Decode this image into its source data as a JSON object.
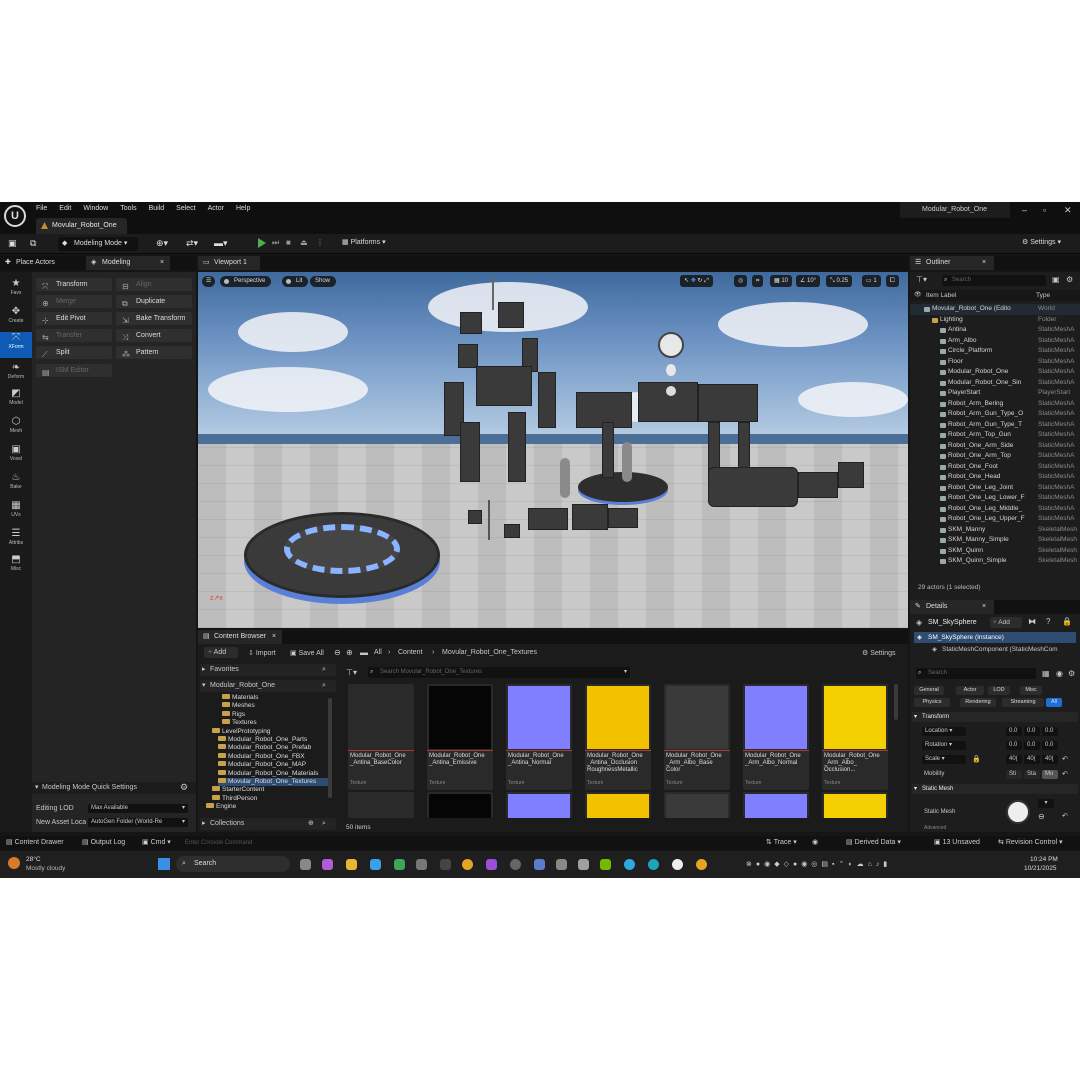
{
  "app": {
    "menu": [
      "File",
      "Edit",
      "Window",
      "Tools",
      "Build",
      "Select",
      "Actor",
      "Help"
    ],
    "project_tab": "Movular_Robot_One",
    "window_title": "Modular_Robot_One"
  },
  "toolbar": {
    "mode": "Modeling Mode",
    "platforms": "Platforms",
    "settings": "Settings"
  },
  "left_tabs": {
    "place_actors": "Place Actors",
    "modeling": "Modeling"
  },
  "left_icons": [
    "Favs",
    "Create",
    "XForm",
    "Deform",
    "Model",
    "Mesh",
    "Voxel",
    "Bake",
    "UVs",
    "Attribs",
    "Misc"
  ],
  "modeling_tools": [
    {
      "label": "Transform",
      "enabled": true
    },
    {
      "label": "Align",
      "enabled": false
    },
    {
      "label": "Merge",
      "enabled": false
    },
    {
      "label": "Duplicate",
      "enabled": true
    },
    {
      "label": "Edit Pivot",
      "enabled": true
    },
    {
      "label": "Bake Transform",
      "enabled": true
    },
    {
      "label": "Transfer",
      "enabled": false
    },
    {
      "label": "Convert",
      "enabled": true
    },
    {
      "label": "Split",
      "enabled": true
    },
    {
      "label": "Pattern",
      "enabled": true
    },
    {
      "label": "ISM Editor",
      "enabled": false
    }
  ],
  "quick_settings": {
    "title": "Modeling Mode Quick Settings",
    "editing_lod_label": "Editing LOD",
    "editing_lod_value": "Max Available",
    "new_asset_label": "New Asset Loca",
    "new_asset_value": "AutoGen Folder (World-Re"
  },
  "viewport": {
    "tab": "Viewport 1",
    "perspective": "Perspective",
    "lit": "Lit",
    "show": "Show",
    "grid": "10",
    "angle": "10°",
    "scale": "0.25",
    "cams": "1"
  },
  "outliner": {
    "tab": "Outliner",
    "search_placeholder": "Search",
    "col_label": "Item Label",
    "col_type": "Type",
    "items": [
      {
        "name": "Movular_Robot_One (Edito",
        "type": "World"
      },
      {
        "name": "Lighting",
        "type": "Folder"
      },
      {
        "name": "Antina",
        "type": "StaticMeshA"
      },
      {
        "name": "Arm_Albo",
        "type": "StaticMeshA"
      },
      {
        "name": "Circle_Platform",
        "type": "StaticMeshA"
      },
      {
        "name": "Floor",
        "type": "StaticMeshA"
      },
      {
        "name": "Modular_Robot_One",
        "type": "StaticMeshA"
      },
      {
        "name": "Modular_Robot_One_Sin",
        "type": "StaticMeshA"
      },
      {
        "name": "PlayerStart",
        "type": "PlayerStart"
      },
      {
        "name": "Robot_Arm_Bering",
        "type": "StaticMeshA"
      },
      {
        "name": "Robot_Arm_Gun_Type_O",
        "type": "StaticMeshA"
      },
      {
        "name": "Robot_Arm_Gun_Type_T",
        "type": "StaticMeshA"
      },
      {
        "name": "Robot_Arm_Top_Gun",
        "type": "StaticMeshA"
      },
      {
        "name": "Robot_One_Arm_Side",
        "type": "StaticMeshA"
      },
      {
        "name": "Robot_One_Arm_Top",
        "type": "StaticMeshA"
      },
      {
        "name": "Robot_One_Foot",
        "type": "StaticMeshA"
      },
      {
        "name": "Robot_One_Head",
        "type": "StaticMeshA"
      },
      {
        "name": "Robot_One_Leg_Joint",
        "type": "StaticMeshA"
      },
      {
        "name": "Robot_One_Leg_Lower_F",
        "type": "StaticMeshA"
      },
      {
        "name": "Robot_One_Leg_Middle_",
        "type": "StaticMeshA"
      },
      {
        "name": "Robot_One_Leg_Upper_F",
        "type": "StaticMeshA"
      },
      {
        "name": "SKM_Manny",
        "type": "SkeletalMesh"
      },
      {
        "name": "SKM_Manny_Simple",
        "type": "SkeletalMesh"
      },
      {
        "name": "SKM_Quinn",
        "type": "SkeletalMesh"
      },
      {
        "name": "SKM_Quinn_Simple",
        "type": "SkeletalMesh"
      }
    ],
    "status": "29 actors (1 selected)"
  },
  "details": {
    "tab": "Details",
    "object": "SM_SkySphere",
    "add": "Add",
    "instance": "SM_SkySphere (Instance)",
    "component": "StaticMeshComponent (StaticMeshCom",
    "search_placeholder": "Search",
    "filters": [
      "General",
      "Actor",
      "LOD",
      "Misc",
      "Physics",
      "Rendering",
      "Streaming",
      "All"
    ],
    "transform_header": "Transform",
    "location": "Location",
    "rotation": "Rotation",
    "scale": "Scale",
    "mobility": "Mobility",
    "mob_options": [
      "Sti",
      "Sta",
      "Mo"
    ],
    "loc_values": [
      "0.0",
      "0.0",
      "0.0"
    ],
    "rot_values": [
      "0.0",
      "0.0",
      "0.0"
    ],
    "scale_values": [
      "40(",
      "40(",
      "40("
    ],
    "static_mesh_header": "Static Mesh",
    "static_mesh_label": "Static Mesh",
    "more": "Advanced"
  },
  "content_browser": {
    "tab": "Content Browser",
    "add": "Add",
    "import": "Import",
    "save_all": "Save All",
    "path": [
      "All",
      "Content",
      "Movular_Robot_One_Textures"
    ],
    "settings": "Settings",
    "favorites": "Favorites",
    "root": "Modular_Robot_One",
    "search_placeholder": "Search Movular_Robot_One_Textures",
    "folders": [
      "Materials",
      "Meshes",
      "Rigs",
      "Textures",
      "LevelPrototyping",
      "Modular_Robot_One_Parts",
      "Modular_Robot_One_Prefab",
      "Modular_Robot_One_FBX",
      "Modular_Robot_One_MAP",
      "Modular_Robot_One_Materials",
      "Movular_Robot_One_Textures",
      "StarterContent",
      "ThirdPerson",
      "Engine"
    ],
    "collections": "Collections",
    "count": "50 items",
    "assets": [
      {
        "name": "Modular_Robot_One _Antina_BaseColor",
        "type": "Texture",
        "color": "#2b2b2b"
      },
      {
        "name": "Modular_Robot_One _Antina_Emissive",
        "type": "Texture",
        "color": "#050505"
      },
      {
        "name": "Modular_Robot_One _Antina_Normal",
        "type": "Texture",
        "color": "#7f7fff"
      },
      {
        "name": "Modular_Robot_One _Antina_Occlusion RoughnessMetallic",
        "type": "Texture",
        "color": "#f2c200"
      },
      {
        "name": "Modular_Robot_One _Arm_Albo_Base Color",
        "type": "Texture",
        "color": "#3a3a3a"
      },
      {
        "name": "Modular_Robot_One _Arm_Albo_Normal",
        "type": "Texture",
        "color": "#8080ff"
      },
      {
        "name": "Modular_Robot_One _Arm_Albo_ Occlusion...",
        "type": "Texture",
        "color": "#f5d000"
      }
    ]
  },
  "statusbar": {
    "content_drawer": "Content Drawer",
    "output_log": "Output Log",
    "cmd": "Cmd",
    "console_placeholder": "Enter Console Command",
    "trace": "Trace",
    "derived": "Derived Data",
    "unsaved": "13 Unsaved",
    "revision": "Revision Control"
  },
  "taskbar": {
    "temp": "28°C",
    "weather": "Mostly cloudy",
    "search": "Search",
    "time": "10:24 PM",
    "date": "10/21/2025"
  }
}
